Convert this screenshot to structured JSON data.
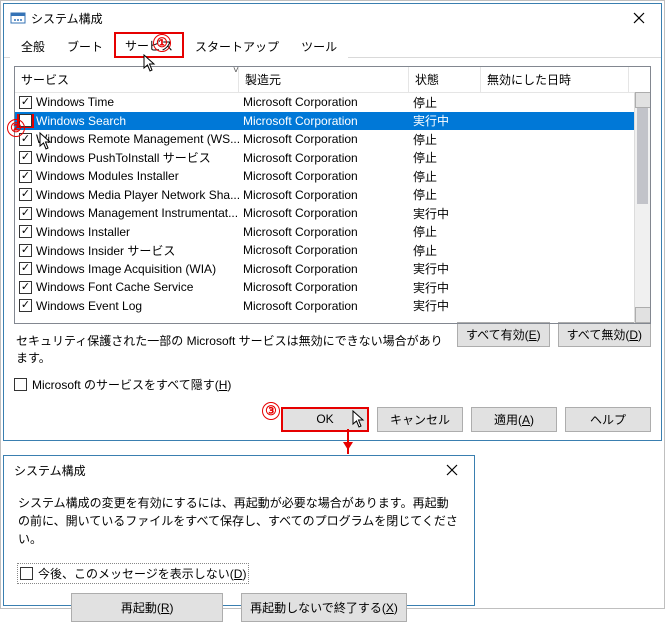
{
  "window1": {
    "title": "システム構成",
    "tabs": [
      "全般",
      "ブート",
      "サービス",
      "スタートアップ",
      "ツール"
    ],
    "active_tab": 2,
    "columns": [
      "サービス",
      "製造元",
      "状態",
      "無効にした日時"
    ],
    "rows": [
      {
        "checked": true,
        "sel": false,
        "name": "Windows Time",
        "mfr": "Microsoft Corporation",
        "state": "停止"
      },
      {
        "checked": false,
        "sel": true,
        "name": "Windows Search",
        "mfr": "Microsoft Corporation",
        "state": "実行中"
      },
      {
        "checked": true,
        "sel": false,
        "name": "Windows Remote Management (WS...",
        "mfr": "Microsoft Corporation",
        "state": "停止"
      },
      {
        "checked": true,
        "sel": false,
        "name": "Windows PushToInstall サービス",
        "mfr": "Microsoft Corporation",
        "state": "停止"
      },
      {
        "checked": true,
        "sel": false,
        "name": "Windows Modules Installer",
        "mfr": "Microsoft Corporation",
        "state": "停止"
      },
      {
        "checked": true,
        "sel": false,
        "name": "Windows Media Player Network Sha...",
        "mfr": "Microsoft Corporation",
        "state": "停止"
      },
      {
        "checked": true,
        "sel": false,
        "name": "Windows Management Instrumentat...",
        "mfr": "Microsoft Corporation",
        "state": "実行中"
      },
      {
        "checked": true,
        "sel": false,
        "name": "Windows Installer",
        "mfr": "Microsoft Corporation",
        "state": "停止"
      },
      {
        "checked": true,
        "sel": false,
        "name": "Windows Insider サービス",
        "mfr": "Microsoft Corporation",
        "state": "停止"
      },
      {
        "checked": true,
        "sel": false,
        "name": "Windows Image Acquisition (WIA)",
        "mfr": "Microsoft Corporation",
        "state": "実行中"
      },
      {
        "checked": true,
        "sel": false,
        "name": "Windows Font Cache Service",
        "mfr": "Microsoft Corporation",
        "state": "実行中"
      },
      {
        "checked": true,
        "sel": false,
        "name": "Windows Event Log",
        "mfr": "Microsoft Corporation",
        "state": "実行中"
      }
    ],
    "note": "セキュリティ保護された一部の Microsoft サービスは無効にできない場合があります。",
    "btn_enable_all": "すべて有効(E)",
    "btn_disable_all": "すべて無効(D)",
    "hide_ms_label": "Microsoft のサービスをすべて隠す(H)",
    "btn_ok": "OK",
    "btn_cancel": "キャンセル",
    "btn_apply": "適用(A)",
    "btn_help": "ヘルプ"
  },
  "window2": {
    "title": "システム構成",
    "msg": "システム構成の変更を有効にするには、再起動が必要な場合があります。再起動の前に、開いているファイルをすべて保存し、すべてのプログラムを閉じてください。",
    "dont_show": "今後、このメッセージを表示しない(D)",
    "btn_restart": "再起動(R)",
    "btn_exit": "再起動しないで終了する(X)"
  },
  "annotations": {
    "m1": "①",
    "m2": "②",
    "m3": "③"
  }
}
